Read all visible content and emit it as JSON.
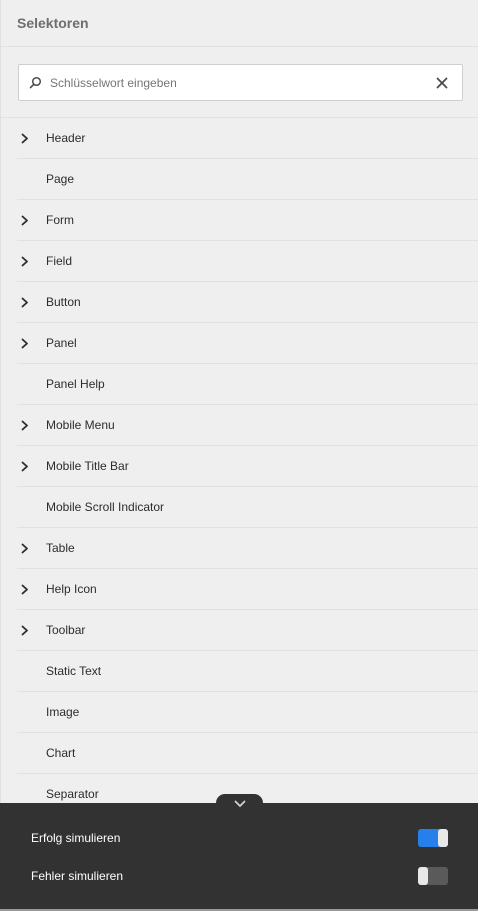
{
  "panel": {
    "title": "Selektoren"
  },
  "search": {
    "placeholder": "Schlüsselwort eingeben"
  },
  "selectors": [
    {
      "label": "Header",
      "expandable": true
    },
    {
      "label": "Page",
      "expandable": false
    },
    {
      "label": "Form",
      "expandable": true
    },
    {
      "label": "Field",
      "expandable": true
    },
    {
      "label": "Button",
      "expandable": true
    },
    {
      "label": "Panel",
      "expandable": true
    },
    {
      "label": "Panel Help",
      "expandable": false
    },
    {
      "label": "Mobile Menu",
      "expandable": true
    },
    {
      "label": "Mobile Title Bar",
      "expandable": true
    },
    {
      "label": "Mobile Scroll Indicator",
      "expandable": false
    },
    {
      "label": "Table",
      "expandable": true
    },
    {
      "label": "Help Icon",
      "expandable": true
    },
    {
      "label": "Toolbar",
      "expandable": true
    },
    {
      "label": "Static Text",
      "expandable": false
    },
    {
      "label": "Image",
      "expandable": false
    },
    {
      "label": "Chart",
      "expandable": false
    },
    {
      "label": "Separator",
      "expandable": false
    }
  ],
  "footer": {
    "success_label": "Erfolg simulieren",
    "success_on": true,
    "error_label": "Fehler simulieren",
    "error_on": false
  },
  "colors": {
    "toggle_on": "#2680eb",
    "toggle_off": "#5a5a5a",
    "footer_bg": "#323232"
  },
  "icons": {
    "search": "search-icon",
    "clear": "close-icon",
    "expand": "chevron-right-icon",
    "collapse": "chevron-down-icon"
  }
}
